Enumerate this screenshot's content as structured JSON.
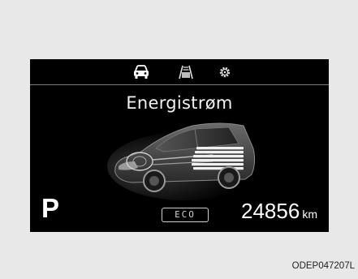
{
  "display": {
    "tabs": [
      {
        "icon": "car-icon",
        "active": true
      },
      {
        "icon": "road-icon",
        "active": false
      },
      {
        "icon": "gear-icon",
        "active": false
      }
    ],
    "title": "Energistrøm",
    "gear": "P",
    "drive_mode": "ECO",
    "odometer_value": "24856",
    "odometer_unit": "km",
    "background_color": "#000000",
    "text_color": "#ffffff"
  },
  "caption": "ODEP047207L"
}
